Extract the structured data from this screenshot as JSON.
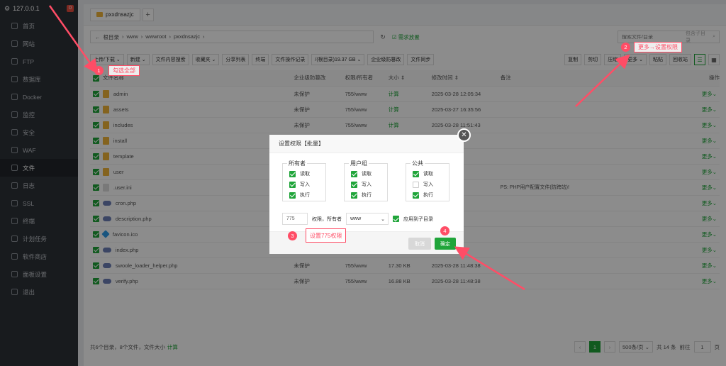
{
  "sidebar": {
    "server": "127.0.0.1",
    "badge": "0",
    "items": [
      {
        "label": "首页",
        "icon": "home-icon"
      },
      {
        "label": "网站",
        "icon": "globe-icon"
      },
      {
        "label": "FTP",
        "icon": "ftp-icon"
      },
      {
        "label": "数据库",
        "icon": "database-icon"
      },
      {
        "label": "Docker",
        "icon": "docker-icon"
      },
      {
        "label": "监控",
        "icon": "monitor-icon"
      },
      {
        "label": "安全",
        "icon": "shield-icon"
      },
      {
        "label": "WAF",
        "icon": "waf-icon"
      },
      {
        "label": "文件",
        "icon": "folder-icon"
      },
      {
        "label": "日志",
        "icon": "log-icon"
      },
      {
        "label": "SSL",
        "icon": "ssl-icon"
      },
      {
        "label": "终端",
        "icon": "terminal-icon"
      },
      {
        "label": "计划任务",
        "icon": "clock-icon"
      },
      {
        "label": "软件商店",
        "icon": "store-icon"
      },
      {
        "label": "面板设置",
        "icon": "gear-icon"
      },
      {
        "label": "退出",
        "icon": "logout-icon"
      }
    ]
  },
  "tab": {
    "label": "pxxdnsazjc",
    "add": "+"
  },
  "path": {
    "back": "←",
    "segments": [
      "根目录",
      "www",
      "wwwroot",
      "pxxdnsazjc"
    ],
    "sep": "›",
    "refresh": "↻",
    "favorite": "☑ 需求放置",
    "search_placeholder": "搜索文件/目录",
    "search_sub": "包含子目录"
  },
  "toolbar": {
    "left": [
      "上传/下载 ⌄",
      "新建 ⌄",
      "文件内容搜索",
      "收藏夹 ⌄",
      "分享列表",
      "终端",
      "文件操作记录",
      "/(根目录)19.37 GB ⌄",
      "企业级防篡改",
      "文件同步"
    ],
    "right": [
      "复制",
      "剪切",
      "压缩",
      "更多 ⌄",
      "粘贴",
      "回收站"
    ]
  },
  "table": {
    "headers": [
      "文件名称",
      "企业级防篡改",
      "权限/所有者",
      "大小 ⇕",
      "修改时间 ⇕",
      "备注",
      "操作"
    ],
    "rows": [
      {
        "name": "admin",
        "type": "dir",
        "protect": "未保护",
        "perm": "755/www",
        "size": "计算",
        "time": "2025-03-28 12:05:34",
        "note": ""
      },
      {
        "name": "assets",
        "type": "dir",
        "protect": "未保护",
        "perm": "755/www",
        "size": "计算",
        "time": "2025-03-27 16:35:56",
        "note": ""
      },
      {
        "name": "includes",
        "type": "dir",
        "protect": "未保护",
        "perm": "755/www",
        "size": "计算",
        "time": "2025-03-28 11:51:43",
        "note": ""
      },
      {
        "name": "install",
        "type": "dir",
        "protect": "",
        "perm": "",
        "size": "",
        "time": "1:26",
        "note": ""
      },
      {
        "name": "template",
        "type": "dir",
        "protect": "",
        "perm": "",
        "size": "",
        "time": "5:49",
        "note": ""
      },
      {
        "name": "user",
        "type": "dir",
        "protect": "",
        "perm": "",
        "size": "",
        "time": "5:47",
        "note": ""
      },
      {
        "name": ".user.ini",
        "type": "ini",
        "protect": "",
        "perm": "",
        "size": "",
        "time": "7:10",
        "note": "PS: PHP用户配置文件(防跨站)!"
      },
      {
        "name": "cron.php",
        "type": "php",
        "protect": "",
        "perm": "",
        "size": "",
        "time": "8:38",
        "note": ""
      },
      {
        "name": "description.php",
        "type": "php",
        "protect": "",
        "perm": "",
        "size": "",
        "time": "8:38",
        "note": ""
      },
      {
        "name": "favicon.ico",
        "type": "ico",
        "protect": "",
        "perm": "",
        "size": "",
        "time": "6:50",
        "note": ""
      },
      {
        "name": "index.php",
        "type": "php",
        "protect": "",
        "perm": "",
        "size": "",
        "time": "8:38",
        "note": ""
      },
      {
        "name": "swoole_loader_helper.php",
        "type": "php",
        "protect": "未保护",
        "perm": "755/www",
        "size": "17.30 KB",
        "time": "2025-03-28 11:48:38",
        "note": ""
      },
      {
        "name": "verify.php",
        "type": "php",
        "protect": "未保护",
        "perm": "755/www",
        "size": "16.88 KB",
        "time": "2025-03-28 11:48:38",
        "note": ""
      }
    ],
    "more": "更多⌄"
  },
  "footer": {
    "summary": "共6个目录，8个文件，文件大小",
    "calc": "计算",
    "page": "1",
    "per_page": "500条/页 ⌄",
    "total": "共 14 条",
    "goto_label": "前往",
    "goto_value": "1",
    "goto_unit": "页",
    "prev": "‹",
    "next": "›"
  },
  "modal": {
    "title": "设置权限【批量】",
    "close": "✕",
    "groups": [
      {
        "label": "所有者",
        "perms": [
          {
            "label": "读取",
            "checked": true
          },
          {
            "label": "写入",
            "checked": true
          },
          {
            "label": "执行",
            "checked": true
          }
        ]
      },
      {
        "label": "用户组",
        "perms": [
          {
            "label": "读取",
            "checked": true
          },
          {
            "label": "写入",
            "checked": true
          },
          {
            "label": "执行",
            "checked": true
          }
        ]
      },
      {
        "label": "公共",
        "perms": [
          {
            "label": "读取",
            "checked": true
          },
          {
            "label": "写入",
            "checked": false
          },
          {
            "label": "执行",
            "checked": true
          }
        ]
      }
    ],
    "perm_value": "775",
    "perm_label": "权限，所有者",
    "owner": "www",
    "apply_sub": "应用到子目录",
    "cancel": "取消",
    "confirm": "确定"
  },
  "annotations": {
    "n1": "1",
    "t1": "勾选全部",
    "n2": "2",
    "t2": "更多→设置权限",
    "n3": "3",
    "t3": "设置775权限",
    "n4": "4",
    "color": "#ff4d66"
  }
}
